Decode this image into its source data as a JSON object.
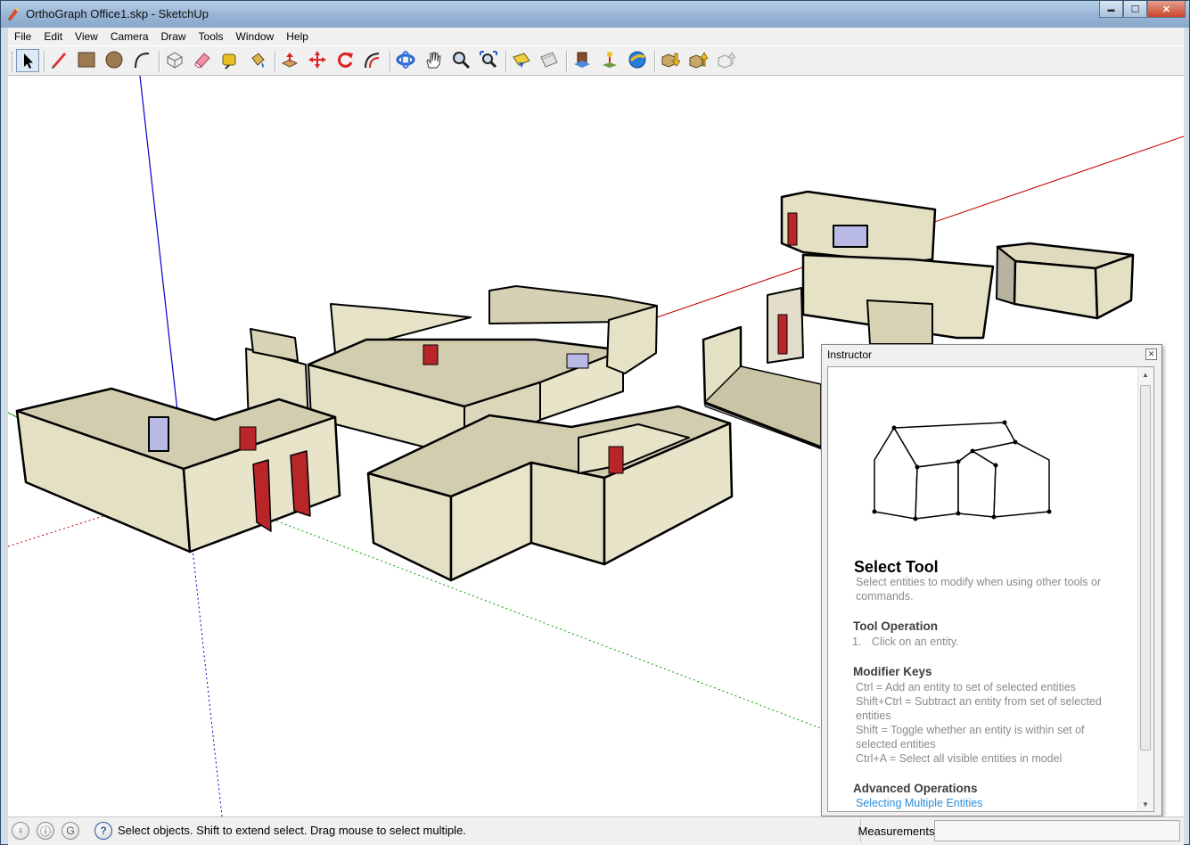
{
  "window": {
    "title": "OrthoGraph Office1.skp - SketchUp",
    "minimize_glyph": "▬",
    "maximize_glyph": "☐",
    "close_glyph": "✕"
  },
  "menubar": {
    "items": [
      {
        "label": "File"
      },
      {
        "label": "Edit"
      },
      {
        "label": "View"
      },
      {
        "label": "Camera"
      },
      {
        "label": "Draw"
      },
      {
        "label": "Tools"
      },
      {
        "label": "Window"
      },
      {
        "label": "Help"
      }
    ]
  },
  "toolbar": {
    "tools": [
      {
        "icon": "select-arrow-icon",
        "active": true
      },
      {
        "icon": "pencil-icon"
      },
      {
        "icon": "rectangle-icon"
      },
      {
        "icon": "circle-icon"
      },
      {
        "icon": "arc-icon"
      },
      {
        "icon": "make-component-icon"
      },
      {
        "icon": "eraser-icon"
      },
      {
        "icon": "tape-measure-icon"
      },
      {
        "icon": "paint-bucket-icon"
      },
      {
        "icon": "push-pull-icon"
      },
      {
        "icon": "move-icon"
      },
      {
        "icon": "rotate-icon"
      },
      {
        "icon": "offset-icon"
      },
      {
        "icon": "orbit-icon"
      },
      {
        "icon": "pan-icon"
      },
      {
        "icon": "zoom-icon"
      },
      {
        "icon": "zoom-extents-icon"
      },
      {
        "icon": "section-plane-icon"
      },
      {
        "icon": "add-location-icon"
      },
      {
        "icon": "toggle-terrain-icon"
      },
      {
        "icon": "photo-textures-icon"
      },
      {
        "icon": "google-earth-icon"
      },
      {
        "icon": "get-models-icon"
      },
      {
        "icon": "share-model-icon"
      },
      {
        "icon": "share-component-icon"
      }
    ]
  },
  "instructor": {
    "title": "Instructor",
    "close_glyph": "✕",
    "heading": "Select Tool",
    "description": "Select entities to modify when using other tools or commands.",
    "tool_operation": {
      "heading": "Tool Operation",
      "steps": [
        {
          "number": "1.",
          "text": "Click on an entity."
        }
      ]
    },
    "modifier_keys": {
      "heading": "Modifier Keys",
      "items": [
        "Ctrl = Add an entity to set of selected entities",
        "Shift+Ctrl = Subtract an entity from set of selected entities",
        "Shift = Toggle whether an entity is within set of selected entities",
        "Ctrl+A = Select all visible entities in model"
      ]
    },
    "advanced": {
      "heading": "Advanced Operations",
      "link": "Selecting Multiple Entities"
    }
  },
  "statusbar": {
    "icons": [
      {
        "icon": "geo-location-icon",
        "glyph": "♀"
      },
      {
        "icon": "credits-icon",
        "glyph": "ⓘ"
      },
      {
        "icon": "user-icon",
        "glyph": "G"
      }
    ],
    "help_glyph": "?",
    "message": "Select objects. Shift to extend select. Drag mouse to select multiple.",
    "measurements_label": "Measurements",
    "measurements_value": ""
  },
  "colors": {
    "wall": "#e4e0c4",
    "wall_shade": "#c9c4a6",
    "door": "#b8262a",
    "window_glass": "#b9b9e6",
    "axis_red": "#c00000",
    "axis_green": "#00a000",
    "axis_blue": "#0000c8",
    "link": "#2d8ed8"
  }
}
